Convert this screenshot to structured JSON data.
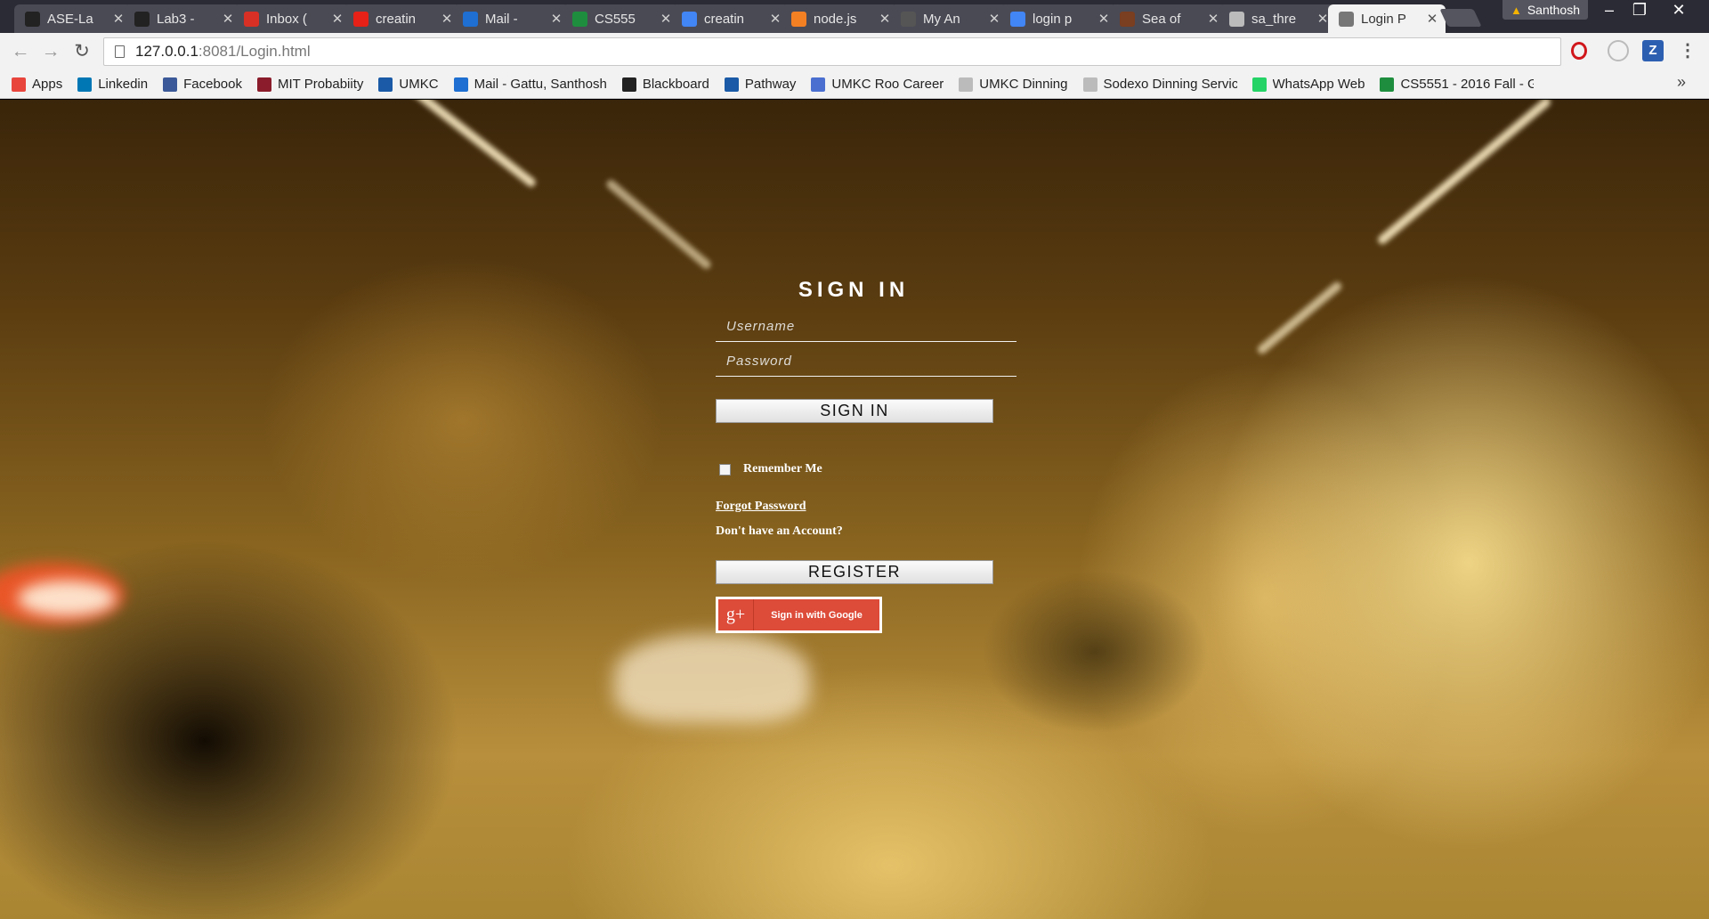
{
  "browser": {
    "tabs": [
      {
        "title": "ASE-La",
        "icon": "github-icon",
        "color": "#222222"
      },
      {
        "title": "Lab3 - ",
        "icon": "github-icon",
        "color": "#222222"
      },
      {
        "title": "Inbox (",
        "icon": "gmail-icon",
        "color": "#d93025"
      },
      {
        "title": "creatin",
        "icon": "youtube-icon",
        "color": "#e62117"
      },
      {
        "title": "Mail - ",
        "icon": "mail-icon",
        "color": "#1e6fd1"
      },
      {
        "title": "CS555",
        "icon": "sheets-icon",
        "color": "#1e8e3e"
      },
      {
        "title": "creatin",
        "icon": "google-icon",
        "color": "#4285f4"
      },
      {
        "title": "node.js",
        "icon": "stackoverflow-icon",
        "color": "#f48024"
      },
      {
        "title": "My An",
        "icon": "ws-icon",
        "color": "#555555"
      },
      {
        "title": "login p",
        "icon": "google-icon",
        "color": "#4285f4"
      },
      {
        "title": "Sea of",
        "icon": "seaof-icon",
        "color": "#7a3e20"
      },
      {
        "title": "sa_thre",
        "icon": "page-icon",
        "color": "#bbbbbb"
      },
      {
        "title": "Login P",
        "icon": "page-icon",
        "color": "#777777",
        "active": true
      }
    ],
    "profile_name": "Santhosh",
    "url_host": "127.0.0.1",
    "url_path": ":8081/Login.html",
    "bookmarks": [
      {
        "label": "Apps",
        "icon": "apps-icon",
        "color": "#e8453c"
      },
      {
        "label": "Linkedin",
        "icon": "linkedin-icon",
        "color": "#0077b5"
      },
      {
        "label": "Facebook",
        "icon": "facebook-icon",
        "color": "#3b5998"
      },
      {
        "label": "MIT Probabiity",
        "icon": "mit-icon",
        "color": "#8a1c2b"
      },
      {
        "label": "UMKC",
        "icon": "umkc-icon",
        "color": "#1a5aa6"
      },
      {
        "label": "Mail - Gattu, Santhosh",
        "icon": "mail-icon",
        "color": "#1e6fd1"
      },
      {
        "label": "Blackboard",
        "icon": "blackboard-icon",
        "color": "#222222"
      },
      {
        "label": "Pathway",
        "icon": "pathway-icon",
        "color": "#1a5aa6"
      },
      {
        "label": "UMKC Roo Career",
        "icon": "roo-icon",
        "color": "#4a6fd0"
      },
      {
        "label": "UMKC Dinning",
        "icon": "page-icon",
        "color": "#bbbbbb"
      },
      {
        "label": "Sodexo Dinning Servic",
        "icon": "page-icon",
        "color": "#bbbbbb"
      },
      {
        "label": "WhatsApp Web",
        "icon": "whatsapp-icon",
        "color": "#25d366"
      },
      {
        "label": "CS5551 - 2016 Fall - G",
        "icon": "sheets-icon",
        "color": "#1e8e3e"
      }
    ]
  },
  "login": {
    "title": "SIGN IN",
    "username_placeholder": "Username",
    "password_placeholder": "Password",
    "signin_button": "SIGN IN",
    "remember_label": "Remember Me",
    "forgot_link": "Forgot Password",
    "no_account_text": "Don't have an Account?",
    "register_button": "REGISTER",
    "google_button": "Sign in with Google",
    "google_logo_text": "g+"
  }
}
